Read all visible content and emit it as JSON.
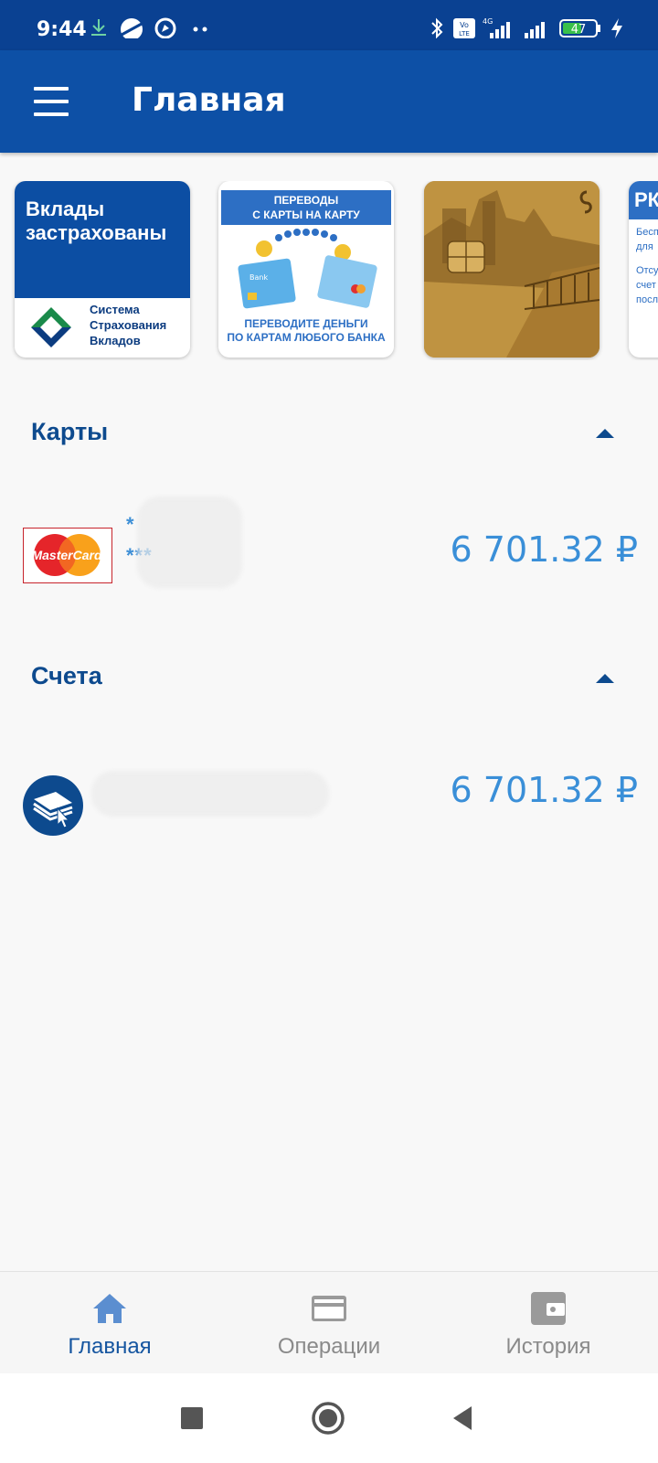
{
  "status_bar": {
    "time": "9:44",
    "battery": "47",
    "network": "4G"
  },
  "app_bar": {
    "title": "Главная"
  },
  "promos": [
    {
      "name": "deposits-insured",
      "line1": "Вклады",
      "line2": "застрахованы",
      "org": [
        "Система",
        "Страхования",
        "Вкладов"
      ]
    },
    {
      "name": "card-transfers",
      "header": [
        "ПЕРЕВОДЫ",
        "С КАРТЫ НА КАРТУ"
      ],
      "footer": [
        "ПЕРЕВОДИТЕ ДЕНЬГИ",
        "ПО КАРТАМ ЛЮБОГО БАНКА"
      ],
      "card_brand": "Bank"
    },
    {
      "name": "card-design"
    },
    {
      "name": "rk-promo",
      "header": "РК",
      "lines": [
        "Бесп",
        "для",
        "Отсу",
        "счет",
        "посл"
      ]
    }
  ],
  "sections": {
    "cards": {
      "title": "Карты"
    },
    "accounts": {
      "title": "Счета"
    }
  },
  "card": {
    "brand": "MasterCard",
    "number_line1": "*",
    "number_line2": "***",
    "amount": "6 701.32 ₽"
  },
  "account": {
    "amount": "6 701.32 ₽"
  },
  "bottom_nav": {
    "home": "Главная",
    "operations": "Операции",
    "history": "История"
  },
  "colors": {
    "primary": "#0d50a6",
    "status_bar": "#0a4192",
    "accent": "#3a8fd8",
    "heading": "#0d4a8e"
  }
}
